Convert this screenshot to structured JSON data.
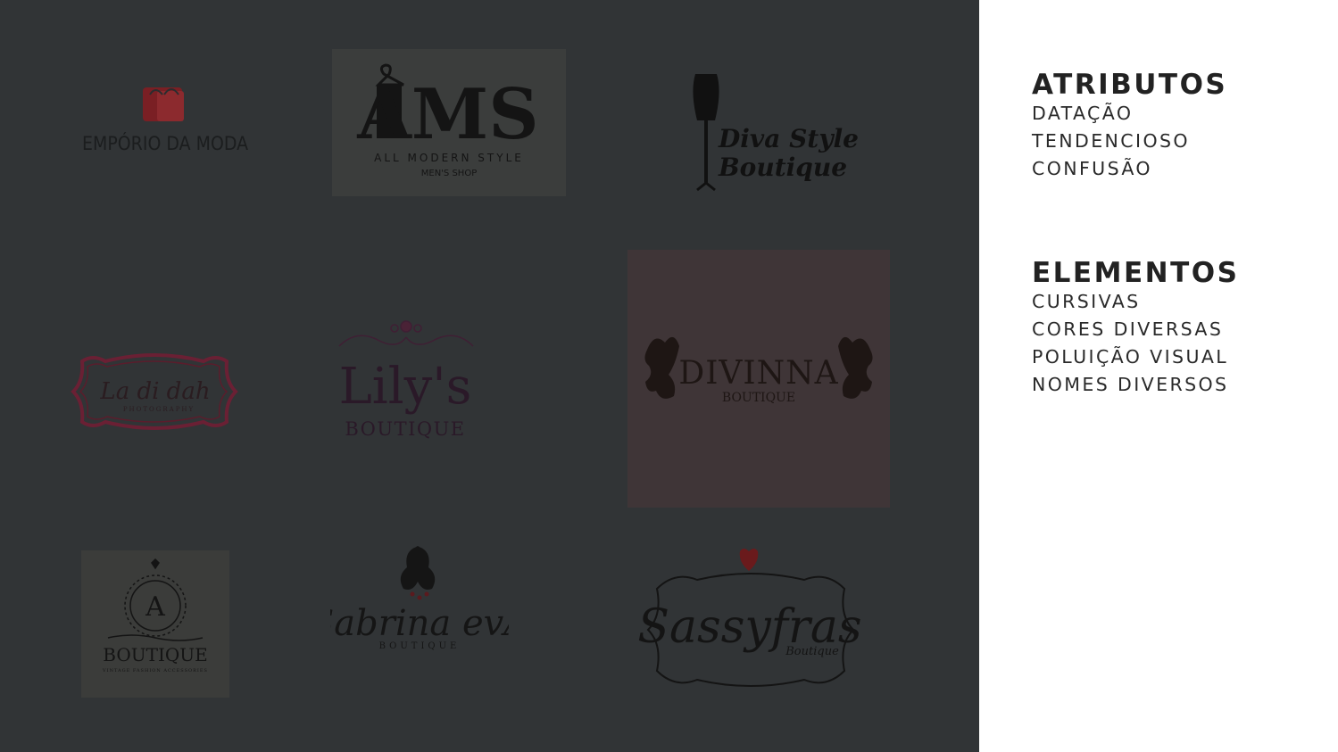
{
  "logos": [
    {
      "id": "emporio",
      "text": "EMPÓRIO DA MODA"
    },
    {
      "id": "ams",
      "mark": "AMS",
      "text": "ALL MODERN STYLE",
      "sub": "MEN'S SHOP"
    },
    {
      "id": "diva",
      "line1": "Diva Style",
      "line2": "Boutique"
    },
    {
      "id": "ladidah",
      "text": "La di dah",
      "sub": "PHOTOGRAPHY"
    },
    {
      "id": "lilys",
      "text": "Lily's",
      "sub": "BOUTIQUE"
    },
    {
      "id": "divinna",
      "text": "DIVINNA",
      "sub": "BOUTIQUE"
    },
    {
      "id": "aboutique",
      "mark": "A",
      "text": "BOUTIQUE",
      "sub": "VINTAGE FASHION ACCESSORIES"
    },
    {
      "id": "sabrina",
      "text": "Sabrina evA",
      "sub": "BOUTIQUE"
    },
    {
      "id": "sassyfras",
      "text": "Sassyfras",
      "sub": "Boutique"
    }
  ],
  "sidebar": {
    "attributes": {
      "title": "ATRIBUTOS",
      "items": [
        "DATAÇÃO",
        "TENDENCIOSO",
        "CONFUSÃO"
      ]
    },
    "elements": {
      "title": "ELEMENTOS",
      "items": [
        "CURSIVAS",
        "CORES DIVERSAS",
        "POLUIÇÃO VISUAL",
        "NOMES DIVERSOS"
      ]
    }
  },
  "colors": {
    "panel": "#313436",
    "text": "#222222"
  }
}
